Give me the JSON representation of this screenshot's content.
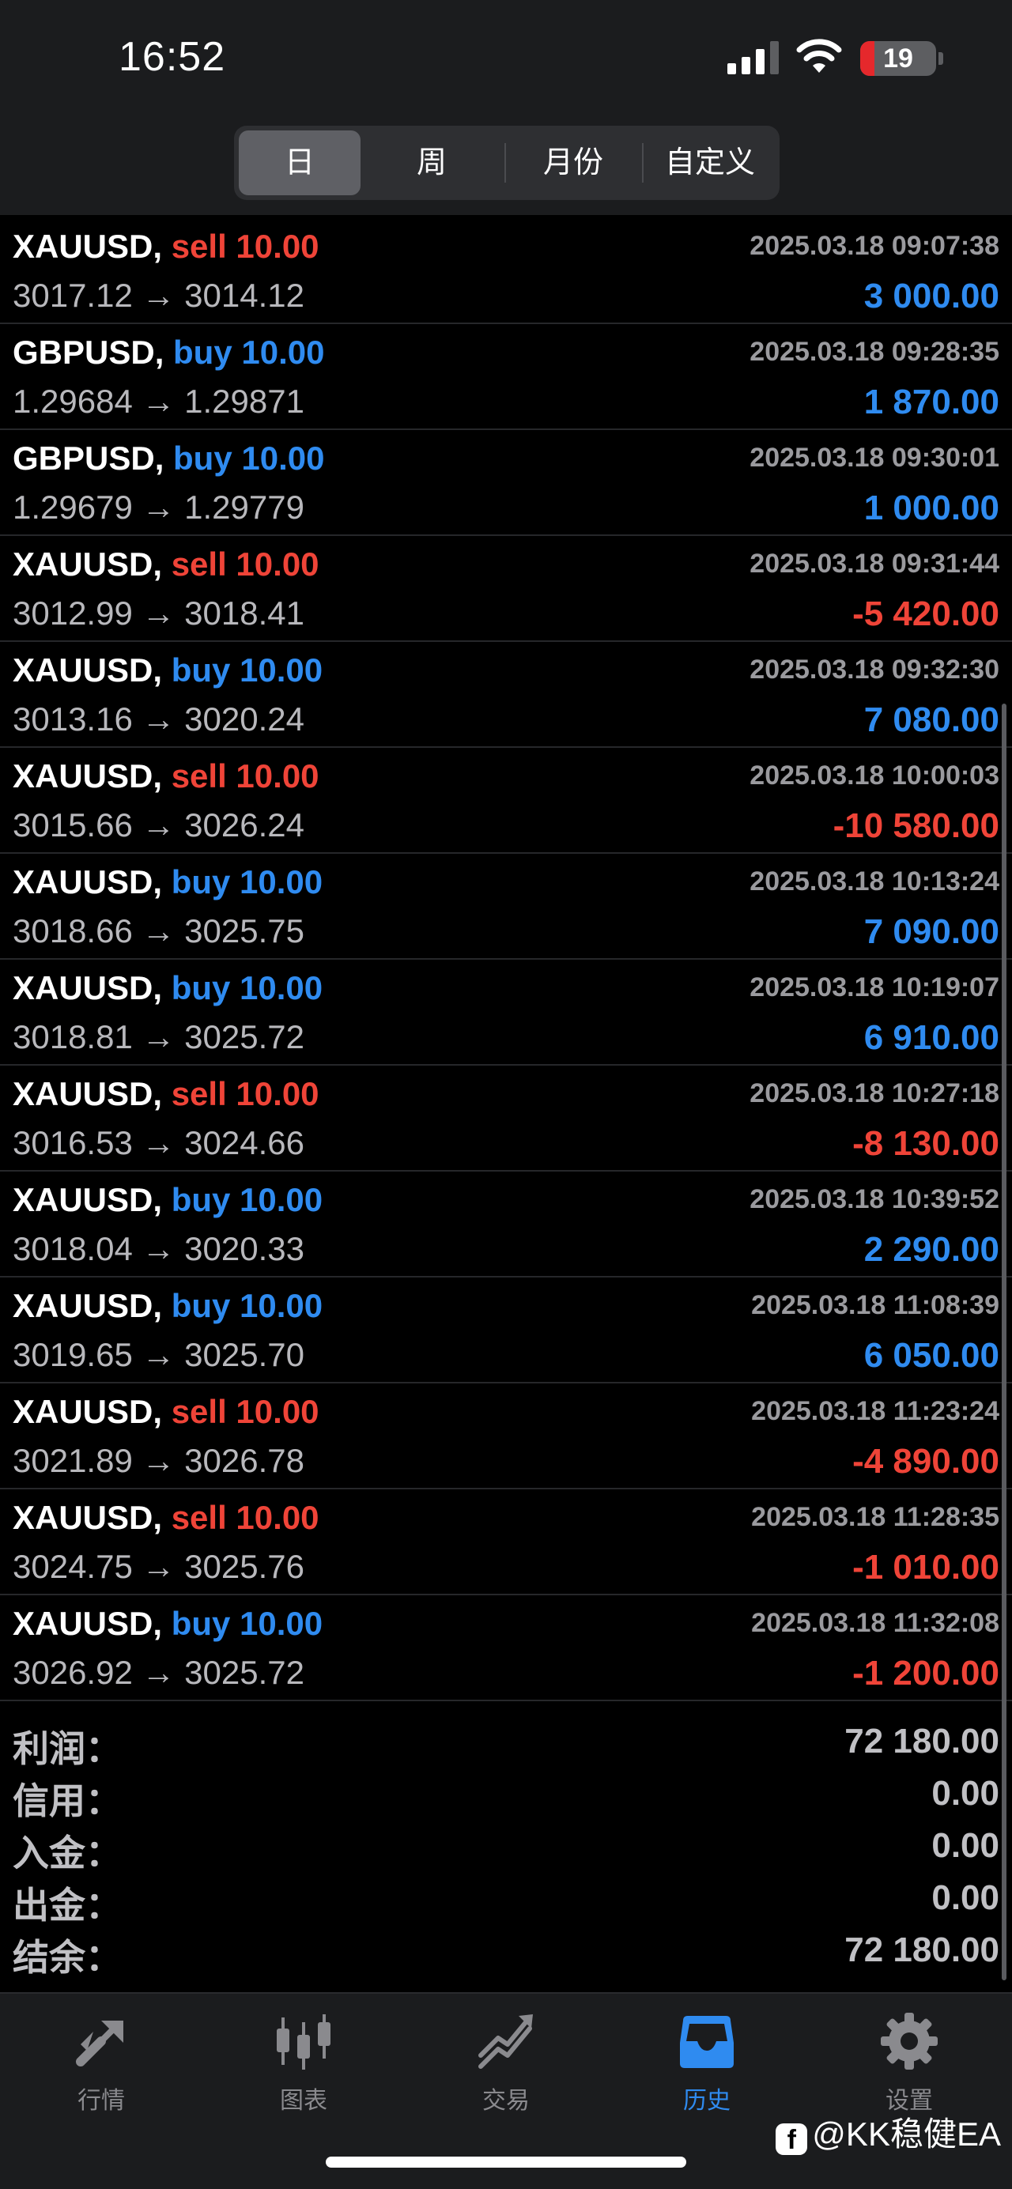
{
  "status_bar": {
    "time": "16:52",
    "battery": "19",
    "battery_level": 0.19
  },
  "period_tabs": [
    {
      "label": "日",
      "active": true
    },
    {
      "label": "周",
      "active": false
    },
    {
      "label": "月份",
      "active": false
    },
    {
      "label": "自定义",
      "active": false
    }
  ],
  "deals": [
    {
      "symbol": "XAUUSD,",
      "action": "sell 10.00",
      "side": "sell",
      "time": "2025.03.18 09:07:38",
      "prices": "3017.12 → 3014.12",
      "profit": "3 000.00",
      "sign": "pos"
    },
    {
      "symbol": "GBPUSD,",
      "action": "buy 10.00",
      "side": "buy",
      "time": "2025.03.18 09:28:35",
      "prices": "1.29684 → 1.29871",
      "profit": "1 870.00",
      "sign": "pos"
    },
    {
      "symbol": "GBPUSD,",
      "action": "buy 10.00",
      "side": "buy",
      "time": "2025.03.18 09:30:01",
      "prices": "1.29679 → 1.29779",
      "profit": "1 000.00",
      "sign": "pos"
    },
    {
      "symbol": "XAUUSD,",
      "action": "sell 10.00",
      "side": "sell",
      "time": "2025.03.18 09:31:44",
      "prices": "3012.99 → 3018.41",
      "profit": "-5 420.00",
      "sign": "neg"
    },
    {
      "symbol": "XAUUSD,",
      "action": "buy 10.00",
      "side": "buy",
      "time": "2025.03.18 09:32:30",
      "prices": "3013.16 → 3020.24",
      "profit": "7 080.00",
      "sign": "pos"
    },
    {
      "symbol": "XAUUSD,",
      "action": "sell 10.00",
      "side": "sell",
      "time": "2025.03.18 10:00:03",
      "prices": "3015.66 → 3026.24",
      "profit": "-10 580.00",
      "sign": "neg"
    },
    {
      "symbol": "XAUUSD,",
      "action": "buy 10.00",
      "side": "buy",
      "time": "2025.03.18 10:13:24",
      "prices": "3018.66 → 3025.75",
      "profit": "7 090.00",
      "sign": "pos"
    },
    {
      "symbol": "XAUUSD,",
      "action": "buy 10.00",
      "side": "buy",
      "time": "2025.03.18 10:19:07",
      "prices": "3018.81 → 3025.72",
      "profit": "6 910.00",
      "sign": "pos"
    },
    {
      "symbol": "XAUUSD,",
      "action": "sell 10.00",
      "side": "sell",
      "time": "2025.03.18 10:27:18",
      "prices": "3016.53 → 3024.66",
      "profit": "-8 130.00",
      "sign": "neg"
    },
    {
      "symbol": "XAUUSD,",
      "action": "buy 10.00",
      "side": "buy",
      "time": "2025.03.18 10:39:52",
      "prices": "3018.04 → 3020.33",
      "profit": "2 290.00",
      "sign": "pos"
    },
    {
      "symbol": "XAUUSD,",
      "action": "buy 10.00",
      "side": "buy",
      "time": "2025.03.18 11:08:39",
      "prices": "3019.65 → 3025.70",
      "profit": "6 050.00",
      "sign": "pos"
    },
    {
      "symbol": "XAUUSD,",
      "action": "sell 10.00",
      "side": "sell",
      "time": "2025.03.18 11:23:24",
      "prices": "3021.89 → 3026.78",
      "profit": "-4 890.00",
      "sign": "neg"
    },
    {
      "symbol": "XAUUSD,",
      "action": "sell 10.00",
      "side": "sell",
      "time": "2025.03.18 11:28:35",
      "prices": "3024.75 → 3025.76",
      "profit": "-1 010.00",
      "sign": "neg"
    },
    {
      "symbol": "XAUUSD,",
      "action": "buy 10.00",
      "side": "buy",
      "time": "2025.03.18 11:32:08",
      "prices": "3026.92 → 3025.72",
      "profit": "-1 200.00",
      "sign": "neg"
    }
  ],
  "summary": [
    {
      "label": "利润：",
      "value": "72 180.00"
    },
    {
      "label": "信用：",
      "value": "0.00"
    },
    {
      "label": "入金：",
      "value": "0.00"
    },
    {
      "label": "出金：",
      "value": "0.00"
    },
    {
      "label": "结余：",
      "value": "72 180.00"
    }
  ],
  "tabbar": [
    {
      "label": "行情",
      "icon": "quotes-icon",
      "active": false
    },
    {
      "label": "图表",
      "icon": "chart-icon",
      "active": false
    },
    {
      "label": "交易",
      "icon": "trade-icon",
      "active": false
    },
    {
      "label": "历史",
      "icon": "history-icon",
      "active": true
    },
    {
      "label": "设置",
      "icon": "settings-icon",
      "active": false
    }
  ],
  "watermark": "@KK稳健EA",
  "colors": {
    "sell": "#ef4438",
    "buy": "#2f8bf0",
    "active_tab": "#2f8bf0",
    "inactive_tab": "#8a8a8e",
    "background": "#000000",
    "header": "#1b1c1e"
  }
}
